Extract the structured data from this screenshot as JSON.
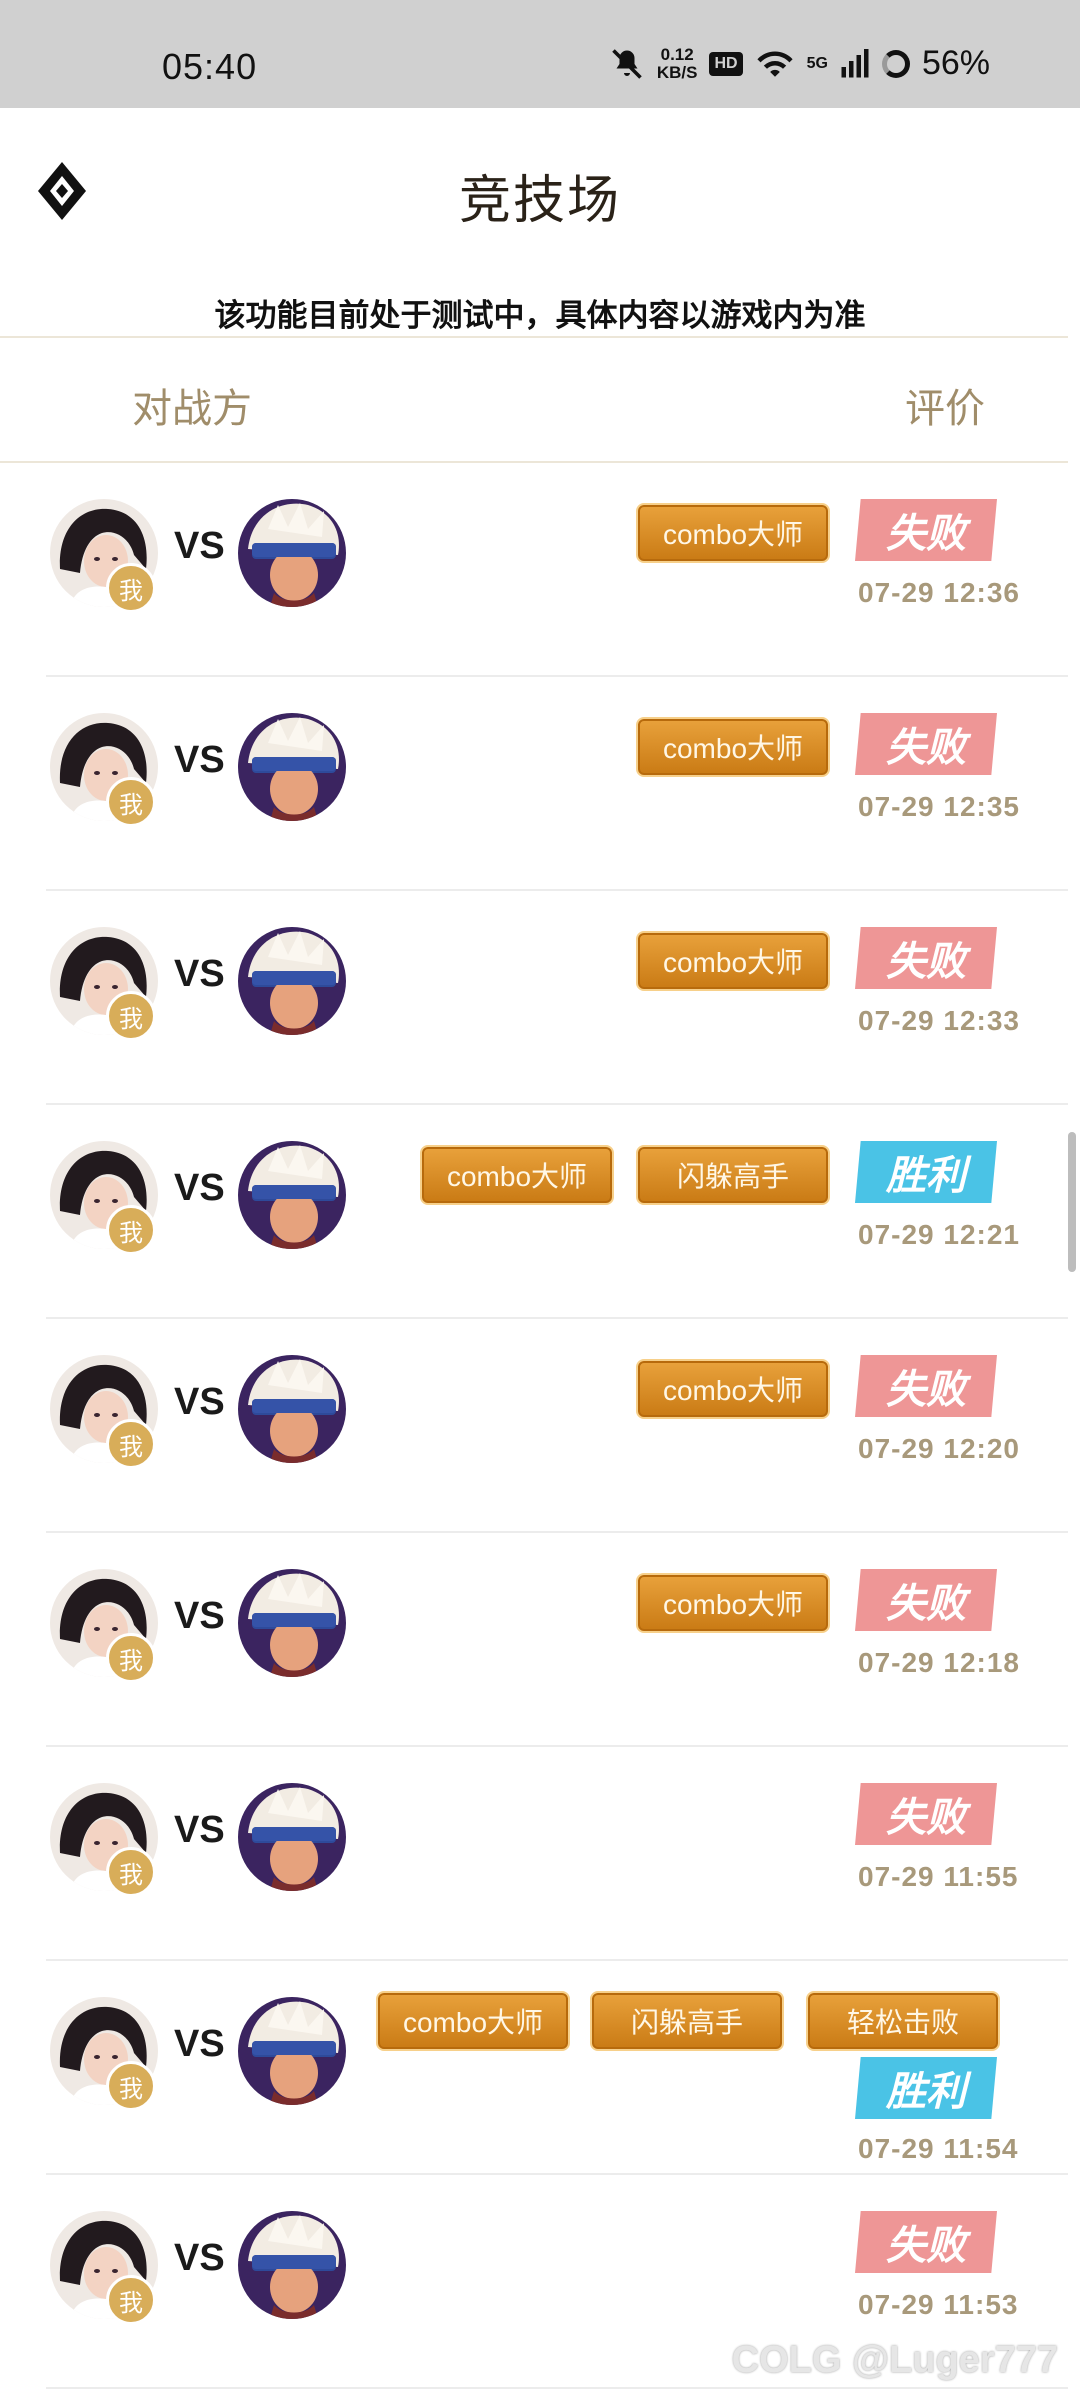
{
  "status_bar": {
    "time": "05:40",
    "speed_value": "0.12",
    "speed_unit": "KB/S",
    "hd_label": "HD",
    "network": "5G",
    "battery": "56%"
  },
  "header": {
    "title": "竞技场",
    "notice": "该功能目前处于测试中，具体内容以游戏内为准"
  },
  "columns": {
    "opponent": "对战方",
    "rating": "评价"
  },
  "me_badge": "我",
  "vs_label": "VS",
  "colors": {
    "lose": "#ee9696",
    "win": "#4ac3e6",
    "tag": "#d98a22",
    "accent": "#a08d6a"
  },
  "matches": [
    {
      "tags": [
        "combo大师"
      ],
      "result": "失败",
      "time": "07-29 12:36"
    },
    {
      "tags": [
        "combo大师"
      ],
      "result": "失败",
      "time": "07-29 12:35"
    },
    {
      "tags": [
        "combo大师"
      ],
      "result": "失败",
      "time": "07-29 12:33"
    },
    {
      "tags": [
        "combo大师",
        "闪躲高手"
      ],
      "result": "胜利",
      "time": "07-29 12:21"
    },
    {
      "tags": [
        "combo大师"
      ],
      "result": "失败",
      "time": "07-29 12:20"
    },
    {
      "tags": [
        "combo大师"
      ],
      "result": "失败",
      "time": "07-29 12:18"
    },
    {
      "tags": [],
      "result": "失败",
      "time": "07-29 11:55"
    },
    {
      "tags": [
        "combo大师",
        "闪躲高手",
        "轻松击败"
      ],
      "result": "胜利",
      "time": "07-29 11:54"
    },
    {
      "tags": [],
      "result": "失败",
      "time": "07-29 11:53"
    }
  ],
  "watermark": "@Luger777",
  "watermark_logo": "COLG"
}
